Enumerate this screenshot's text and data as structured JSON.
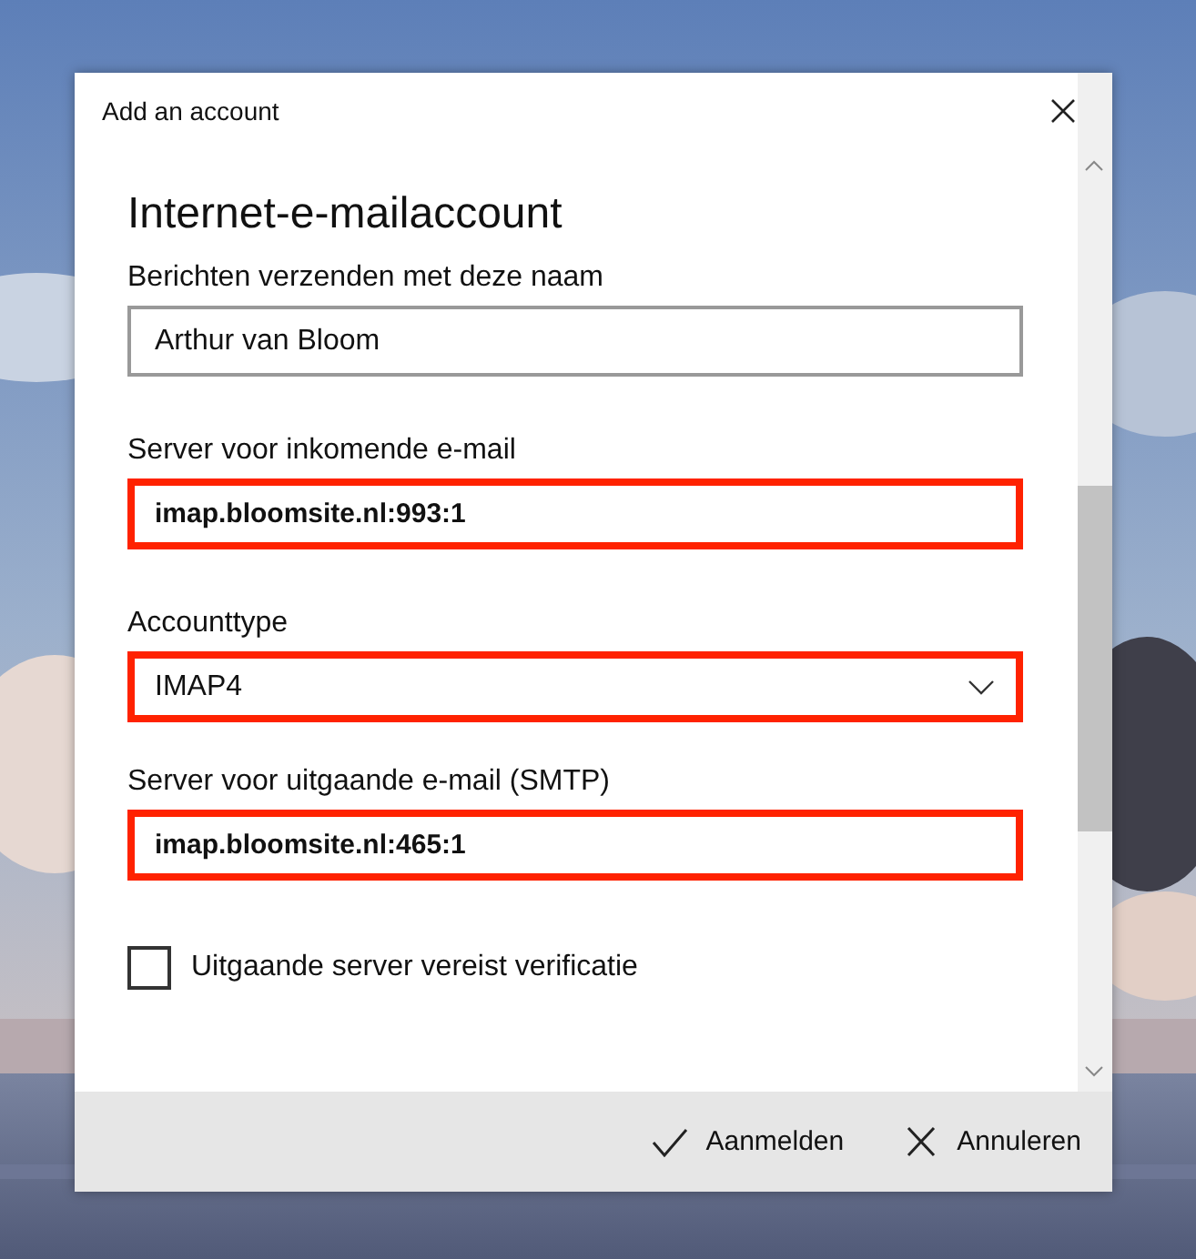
{
  "window": {
    "title": "Add an account"
  },
  "heading": "Internet-e-mailaccount",
  "fields": [
    {
      "kind": "text",
      "label": "Berichten verzenden met deze naam",
      "value": "Arthur van Bloom",
      "highlighted": false
    },
    {
      "kind": "text",
      "label": "Server voor inkomende e-mail",
      "value": "imap.bloomsite.nl:993:1",
      "highlighted": true
    },
    {
      "kind": "dropdown",
      "label": "Accounttype",
      "value": "IMAP4",
      "highlighted": true
    },
    {
      "kind": "text",
      "label": "Server voor uitgaande e-mail (SMTP)",
      "value": "imap.bloomsite.nl:465:1",
      "highlighted": true
    }
  ],
  "checkbox": {
    "label": "Uitgaande server vereist verificatie",
    "checked": false
  },
  "buttons": [
    {
      "kind": "confirm",
      "label": "Aanmelden"
    },
    {
      "kind": "cancel",
      "label": "Annuleren"
    }
  ]
}
